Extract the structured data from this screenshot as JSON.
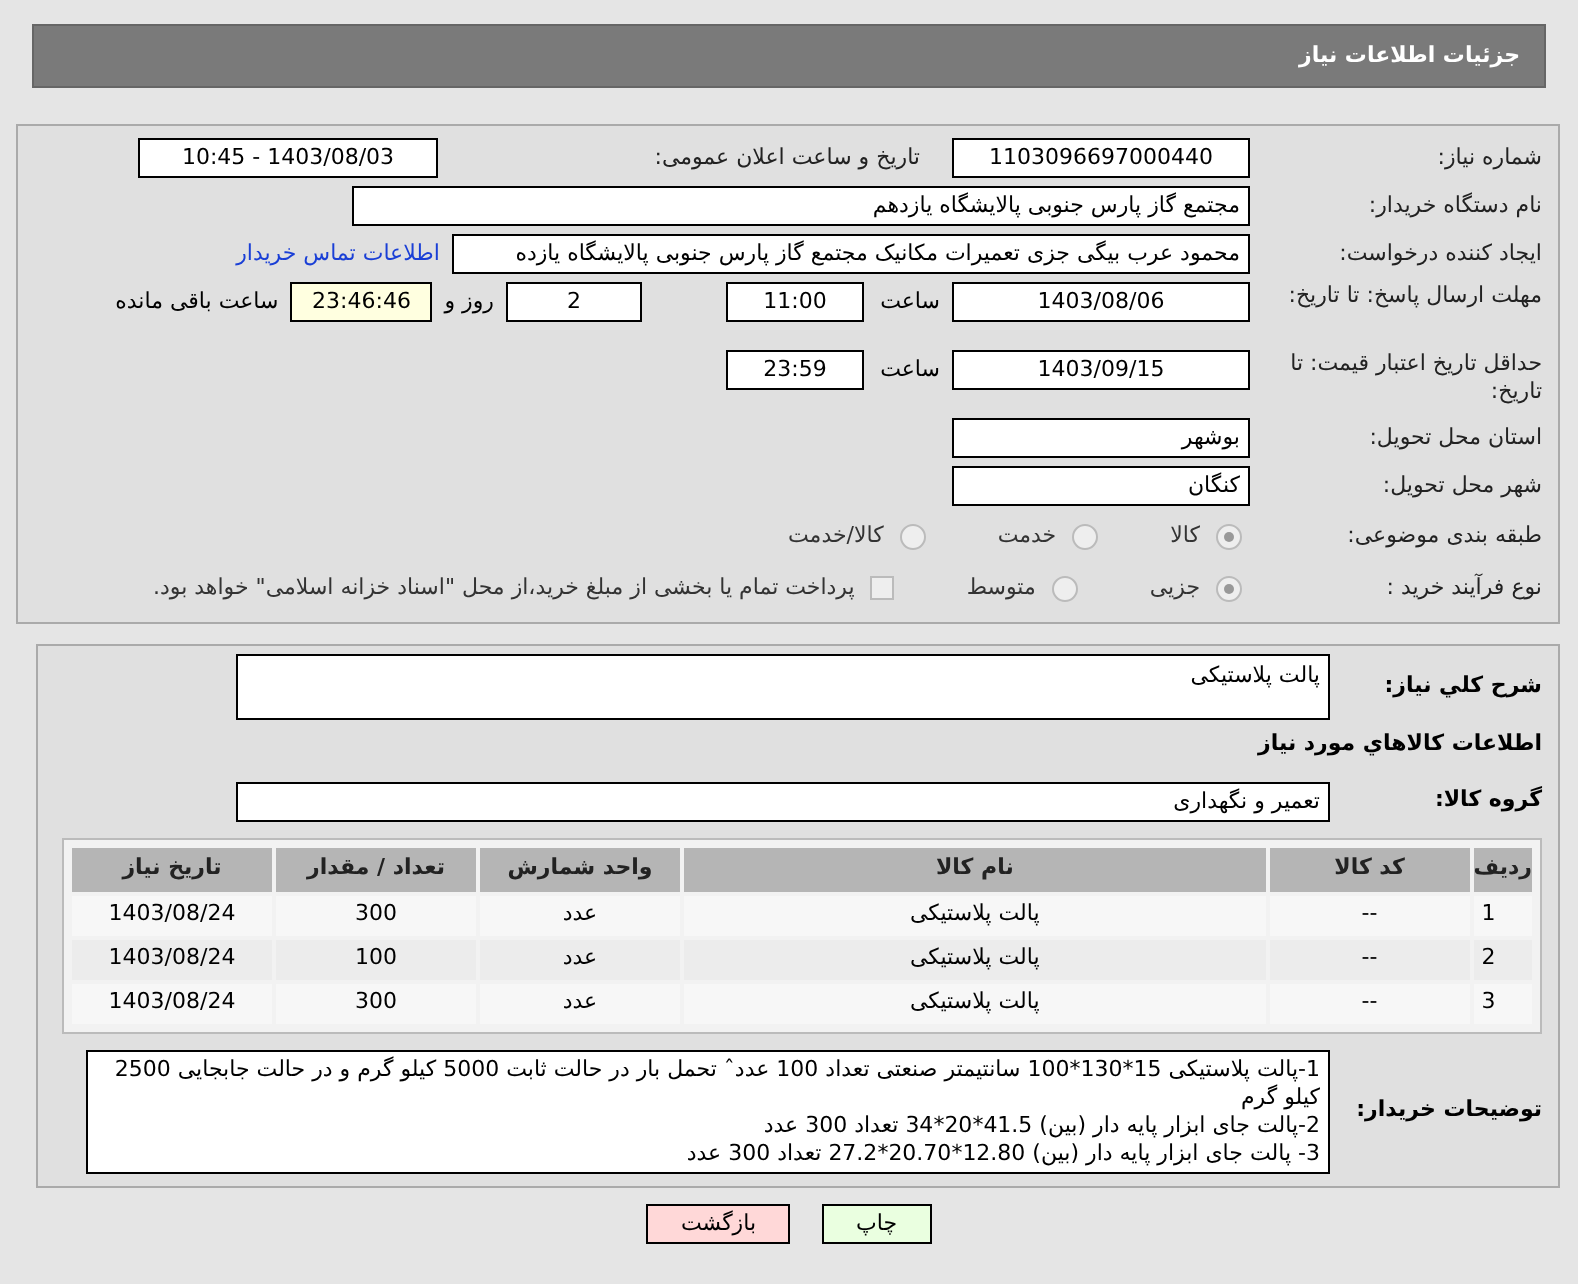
{
  "header": {
    "title": "جزئیات اطلاعات نیاز"
  },
  "need_number": {
    "label": "شماره نیاز:",
    "value": "1103096697000440"
  },
  "announce": {
    "label": "تاریخ و ساعت اعلان عمومی:",
    "value": "1403/08/03 - 10:45"
  },
  "buyer_org": {
    "label": "نام دستگاه خریدار:",
    "value": "مجتمع گاز پارس جنوبی  پالایشگاه یازدهم"
  },
  "requester": {
    "label": "ایجاد کننده درخواست:",
    "value": "محمود عرب بیگی جزی تعمیرات مکانیک مجتمع گاز پارس جنوبی  پالایشگاه یازده",
    "link": "اطلاعات تماس خریدار"
  },
  "deadline": {
    "label": "مهلت ارسال پاسخ: تا تاریخ:",
    "date": "1403/08/06",
    "time_label": "ساعت",
    "time": "11:00",
    "days": "2",
    "days_label": "روز و",
    "remaining": "23:46:46",
    "remaining_label": "ساعت باقی مانده"
  },
  "validity": {
    "label": "حداقل تاریخ اعتبار قیمت: تا تاریخ:",
    "date": "1403/09/15",
    "time_label": "ساعت",
    "time": "23:59"
  },
  "province": {
    "label": "استان محل تحویل:",
    "value": "بوشهر"
  },
  "city": {
    "label": "شهر محل تحویل:",
    "value": "کنگان"
  },
  "category": {
    "label": "طبقه بندی موضوعی:",
    "options": [
      {
        "label": "کالا",
        "selected": true
      },
      {
        "label": "خدمت",
        "selected": false
      },
      {
        "label": "کالا/خدمت",
        "selected": false
      }
    ]
  },
  "process": {
    "label": "نوع فرآیند خرید :",
    "options": [
      {
        "label": "جزیی",
        "selected": true
      },
      {
        "label": "متوسط",
        "selected": false
      }
    ],
    "treasury": {
      "label": "پرداخت تمام یا بخشی از مبلغ خرید،از محل \"اسناد خزانه اسلامی\" خواهد بود.",
      "checked": false
    }
  },
  "summary": {
    "label": "شرح کلي نياز:",
    "value": "پالت پلاستیکی"
  },
  "goods_heading": "اطلاعات كالاهاي مورد نياز",
  "goods_group": {
    "label": "گروه کالا:",
    "value": "تعمیر و نگهداری"
  },
  "table": {
    "columns": [
      "ردیف",
      "کد کالا",
      "نام کالا",
      "واحد شمارش",
      "تعداد / مقدار",
      "تاریخ نیاز"
    ],
    "rows": [
      [
        "1",
        "--",
        "پالت پلاستیکی",
        "عدد",
        "300",
        "1403/08/24"
      ],
      [
        "2",
        "--",
        "پالت پلاستیکی",
        "عدد",
        "100",
        "1403/08/24"
      ],
      [
        "3",
        "--",
        "پالت پلاستیکی",
        "عدد",
        "300",
        "1403/08/24"
      ]
    ]
  },
  "buyer_notes": {
    "label": "توضیحات خریدار:",
    "lines": [
      "1-پالت پلاستیکی 15*130*100 سانتیمتر صنعتی تعداد 100 عددˆ تحمل بار در حالت ثابت 5000 کیلو گرم و در حالت جابجایی 2500 کیلو گرم",
      "2-پالت جای ابزار پایه دار (بین) 41.5*20*34 تعداد 300 عدد",
      "3- پالت جای ابزار پایه دار (بین) 12.80*20.70*27.2 تعداد 300 عدد"
    ]
  },
  "buttons": [
    {
      "label": "چاپ",
      "kind": "print"
    },
    {
      "label": "بازگشت",
      "kind": "back"
    }
  ]
}
